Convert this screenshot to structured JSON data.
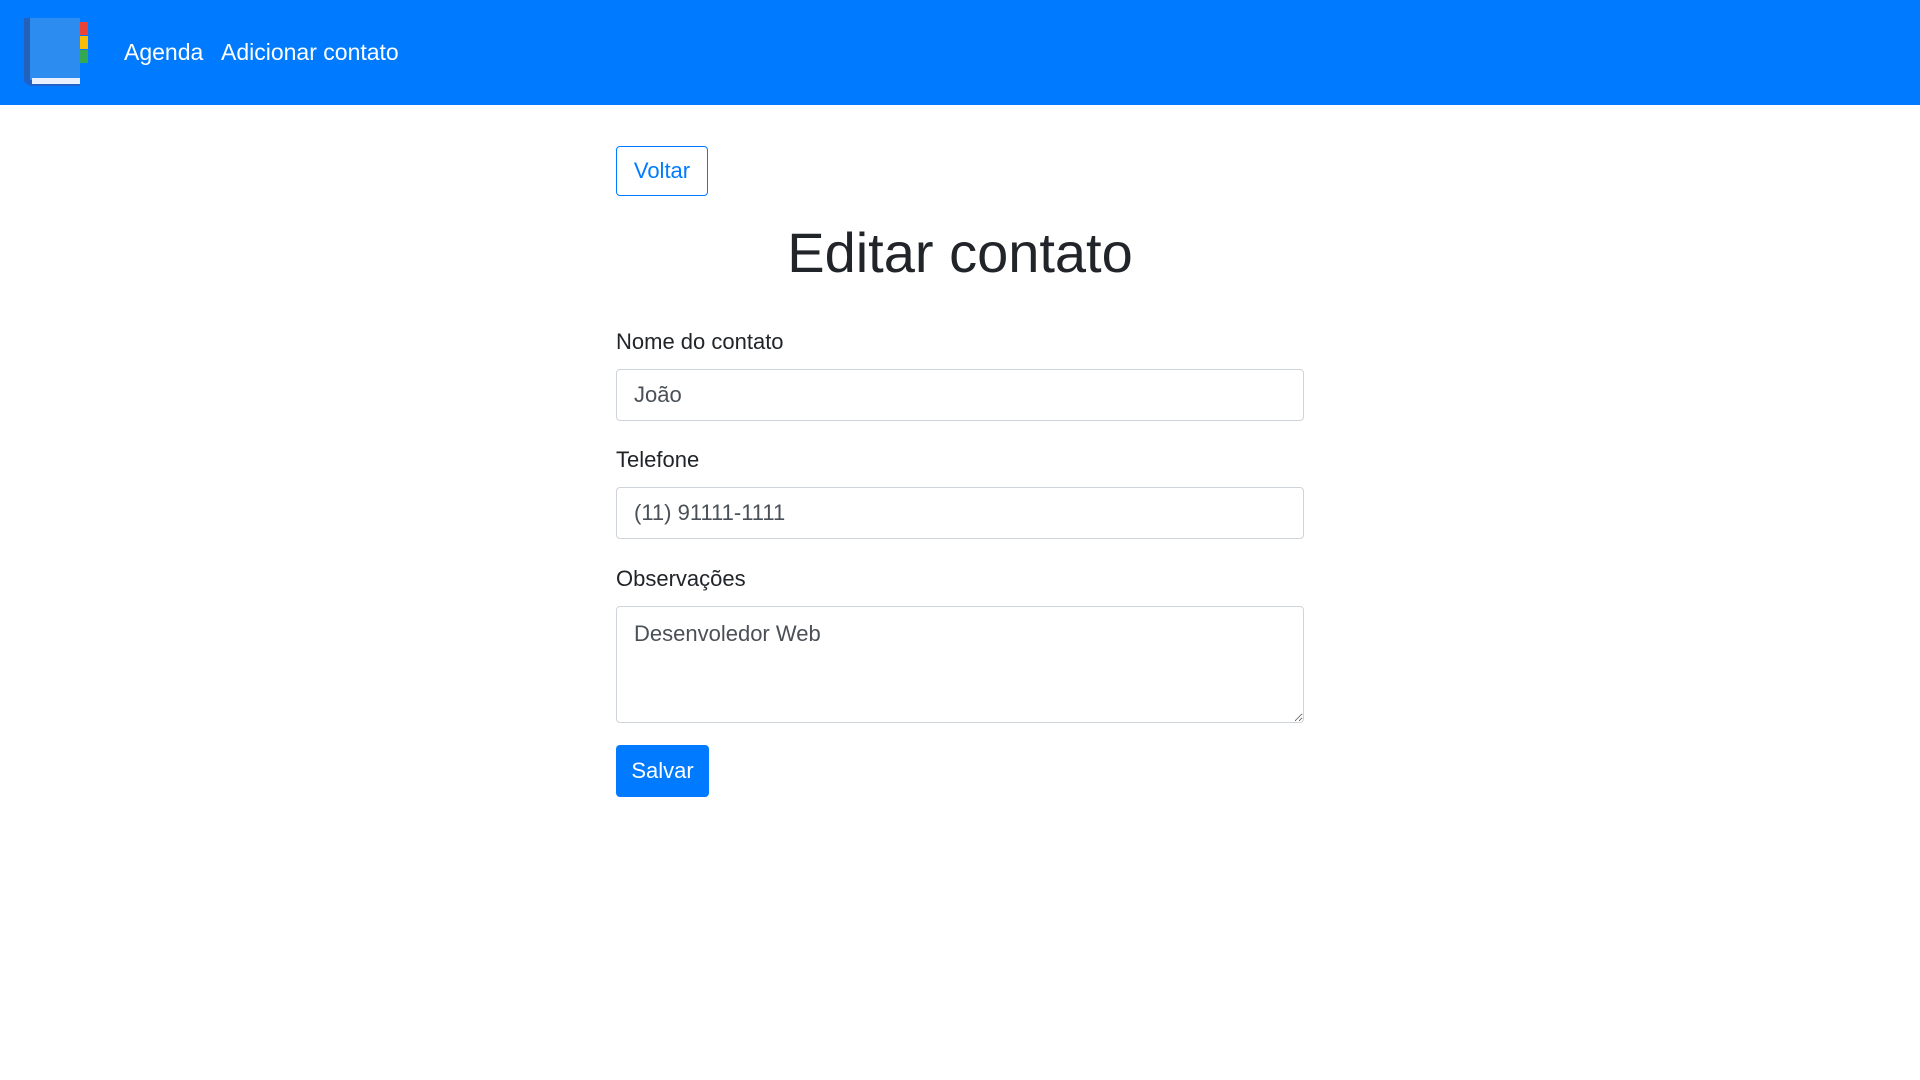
{
  "navbar": {
    "logo_icon": "address-book-icon",
    "links": [
      {
        "label": "Agenda"
      },
      {
        "label": "Adicionar contato"
      }
    ],
    "background_color": "#007bff"
  },
  "page": {
    "back_button_label": "Voltar",
    "title": "Editar contato"
  },
  "form": {
    "name_label": "Nome do contato",
    "name_value": "João",
    "phone_label": "Telefone",
    "phone_value": "(11) 91111-1111",
    "notes_label": "Observações",
    "notes_value": "Desenvoledor Web",
    "save_label": "Salvar"
  }
}
